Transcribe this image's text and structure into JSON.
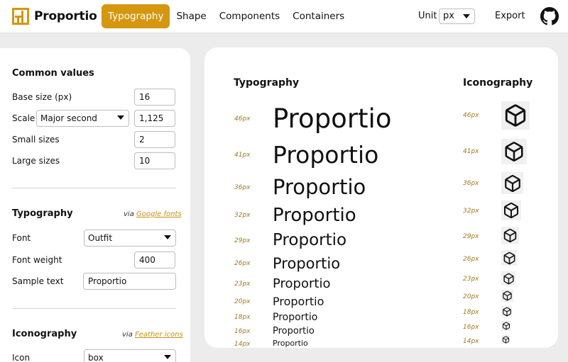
{
  "header": {
    "brand": "Proportio",
    "nav": [
      {
        "label": "Typography",
        "active": true
      },
      {
        "label": "Shape",
        "active": false
      },
      {
        "label": "Components",
        "active": false
      },
      {
        "label": "Containers",
        "active": false
      }
    ],
    "unit_label": "Unit",
    "unit_value": "px",
    "export_label": "Export",
    "accent_color": "#d4970f"
  },
  "common": {
    "title": "Common values",
    "base_size_label": "Base size (px)",
    "base_size": "16",
    "scale_label": "Scale",
    "scale_select": "Major second",
    "scale_value": "1,125",
    "small_sizes_label": "Small sizes",
    "small_sizes": "2",
    "large_sizes_label": "Large sizes",
    "large_sizes": "10"
  },
  "typography_settings": {
    "title": "Typography",
    "via_prefix": "via",
    "via_link": "Google fonts",
    "font_label": "Font",
    "font": "Outfit",
    "weight_label": "Font weight",
    "weight": "400",
    "sample_label": "Sample text",
    "sample": "Proportio"
  },
  "iconography_settings": {
    "title": "Iconography",
    "via_prefix": "via",
    "via_link": "Feather icons",
    "icon_label": "Icon",
    "icon": "box"
  },
  "preview": {
    "typography_heading": "Typography",
    "iconography_heading": "Iconography",
    "sample_text": "Proportio",
    "icon_name": "box-icon",
    "sizes": [
      "46px",
      "41px",
      "36px",
      "32px",
      "29px",
      "26px",
      "23px",
      "20px",
      "18px",
      "16px",
      "14px"
    ]
  }
}
